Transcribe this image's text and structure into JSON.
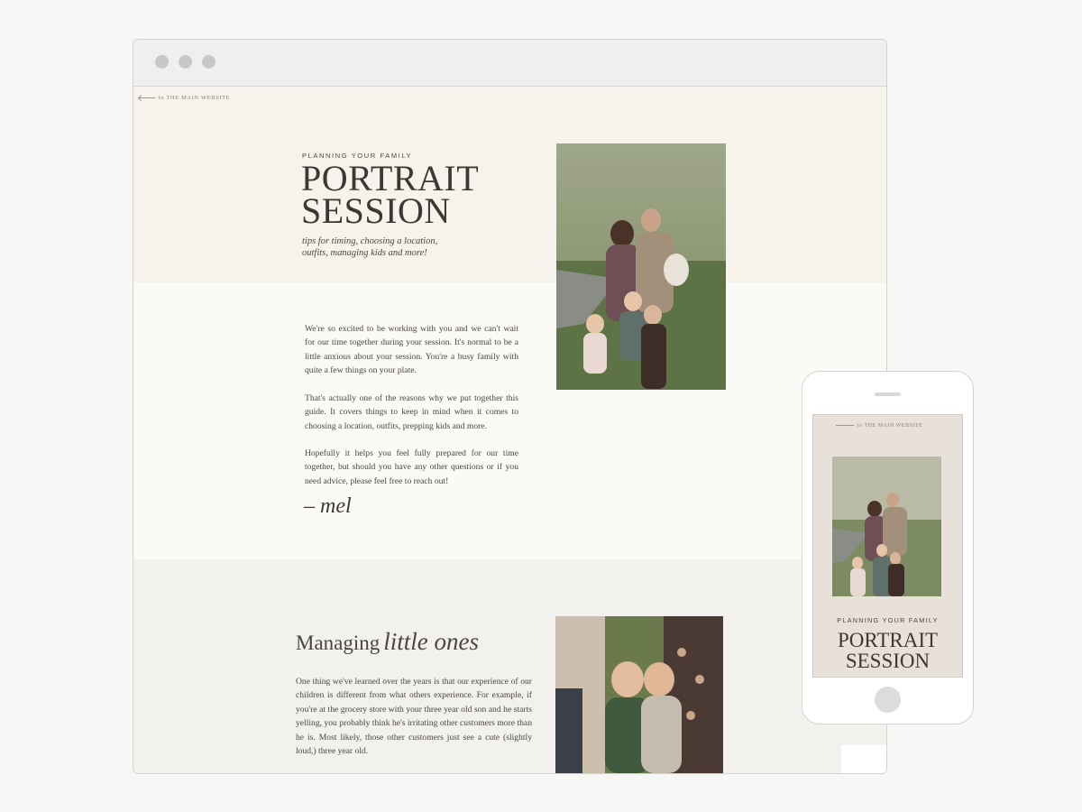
{
  "browser": {
    "window_dots": [
      "close",
      "minimize",
      "maximize"
    ]
  },
  "site": {
    "back_link": "to THE MAIN WEBSITE",
    "hero": {
      "eyebrow": "PLANNING YOUR FAMILY",
      "title_line1": "PORTRAIT",
      "title_line2": "SESSION",
      "subtitle": "tips for timing, choosing a location, outfits, managing kids and more!",
      "photo_desc": "family-portrait-photo"
    },
    "intro": {
      "paragraphs": [
        "We're so excited to be working with you and we can't wait for our time together during your session. It's normal to be a little anxious about your session. You're a busy family with quite a few things on your plate.",
        "That's actually one of the reasons why we put together this guide. It covers things to keep in mind when it comes to choosing a location, outfits, prepping kids and more.",
        "Hopefully it helps you feel fully prepared for our time together, but should you have any other questions or if you need advice, please feel free to reach out!"
      ],
      "signature": "– mel"
    },
    "managing": {
      "heading_plain": "Managing",
      "heading_script": "little ones",
      "body": "One thing we've learned over the years is that our experience of our children is different from what others experience. For example, if you're at the grocery store with your three year old son and he starts yelling, you probably think he's irritating other customers more than he is. Most likely, those other customers just see a cute (slightly loud,) three year old."
    }
  },
  "mobile": {
    "back_link": "to THE MAIN WEBSITE",
    "eyebrow": "PLANNING YOUR FAMILY",
    "title_line1": "PORTRAIT",
    "title_line2": "SESSION"
  },
  "colors": {
    "hero_bg": "#f6f2ec",
    "intro_bg": "#fbfaf7",
    "managing_bg": "#f2f1ee",
    "text": "#3f3a36",
    "mobile_bg": "#e7e1da"
  }
}
